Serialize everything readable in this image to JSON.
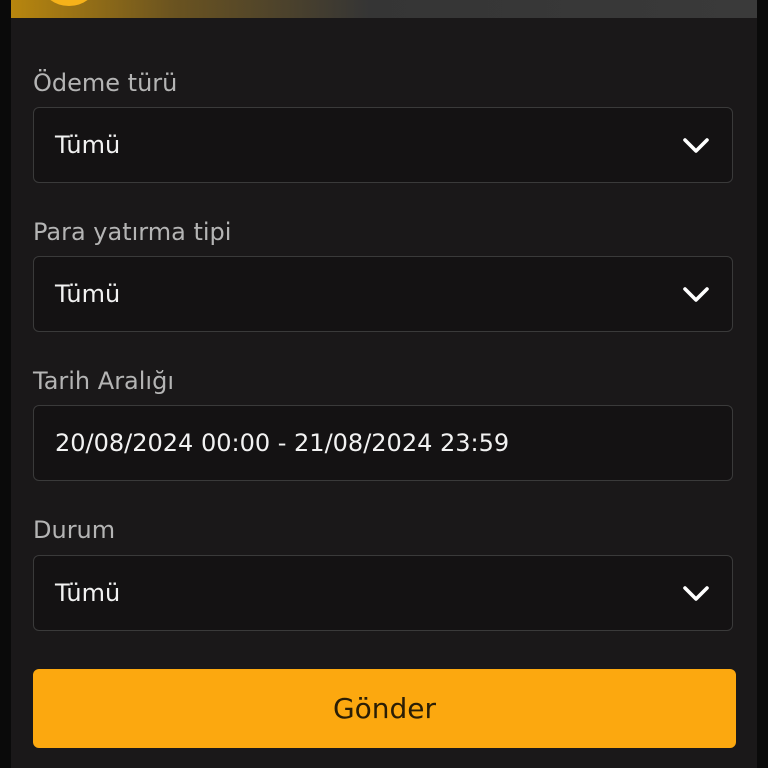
{
  "form": {
    "payment_type": {
      "label": "Ödeme türü",
      "value": "Tümü"
    },
    "deposit_type": {
      "label": "Para yatırma tipi",
      "value": "Tümü"
    },
    "date_range": {
      "label": "Tarih Aralığı",
      "value": "20/08/2024 00:00 - 21/08/2024 23:59"
    },
    "status": {
      "label": "Durum",
      "value": "Tümü"
    },
    "submit_label": "Gönder"
  },
  "colors": {
    "accent": "#fca80f",
    "panel_bg": "#1a1819",
    "field_bg": "#141213",
    "label_text": "#b4b4b4",
    "value_text": "#f2f2f2"
  },
  "icons": {
    "dropdown": "chevron-down-icon"
  }
}
